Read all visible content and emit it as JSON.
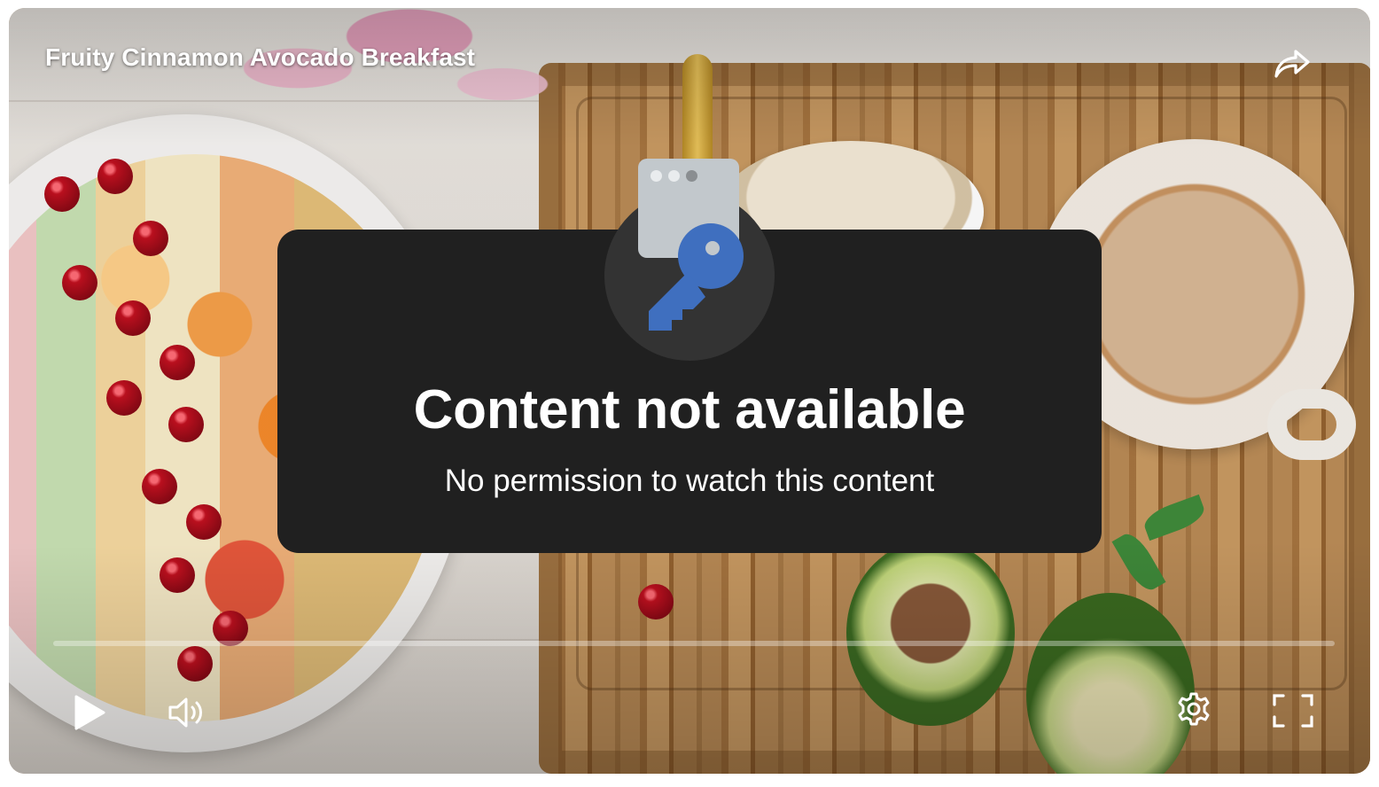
{
  "player": {
    "title": "Fruity Cinnamon Avocado Breakfast",
    "progress_fraction": 0.0
  },
  "error": {
    "title": "Content not available",
    "message": "No permission to watch this content"
  },
  "controls": {
    "play_icon": "play-icon",
    "volume_icon": "volume-icon",
    "settings_icon": "gear-icon",
    "fullscreen_icon": "fullscreen-icon",
    "share_icon": "share-icon"
  },
  "colors": {
    "card_bg": "#202020",
    "key_blue": "#3f6fbf",
    "doc_gray": "#c2c8cc"
  }
}
